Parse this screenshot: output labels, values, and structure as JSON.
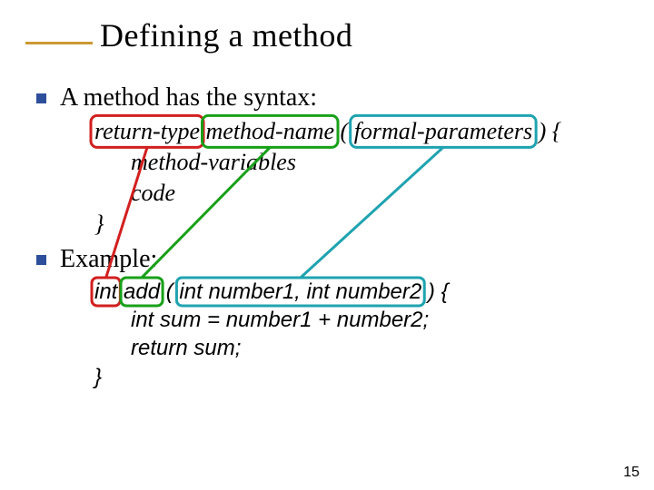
{
  "title": "Defining a method",
  "bullet1": "A method has the syntax:",
  "syntax": {
    "return_type": "return-type",
    "method_name": "method-name",
    "lpar": "(",
    "formal_params": "formal-parameters",
    "rpar": ")",
    "open_brace": "{",
    "method_vars": "method-variables",
    "code_word": "code",
    "close_brace": "}"
  },
  "bullet2": "Example:",
  "example": {
    "ret": "int",
    "name": "add",
    "lpar": "(",
    "params": "int number1, int number2",
    "rpar": ")",
    "open_brace": "{",
    "line1": "int sum = number1 + number2;",
    "line2": "return sum;",
    "close_brace": "}"
  },
  "page": "15",
  "colors": {
    "red": "#d21f1f",
    "green": "#18a018",
    "teal": "#1fa3b0"
  }
}
